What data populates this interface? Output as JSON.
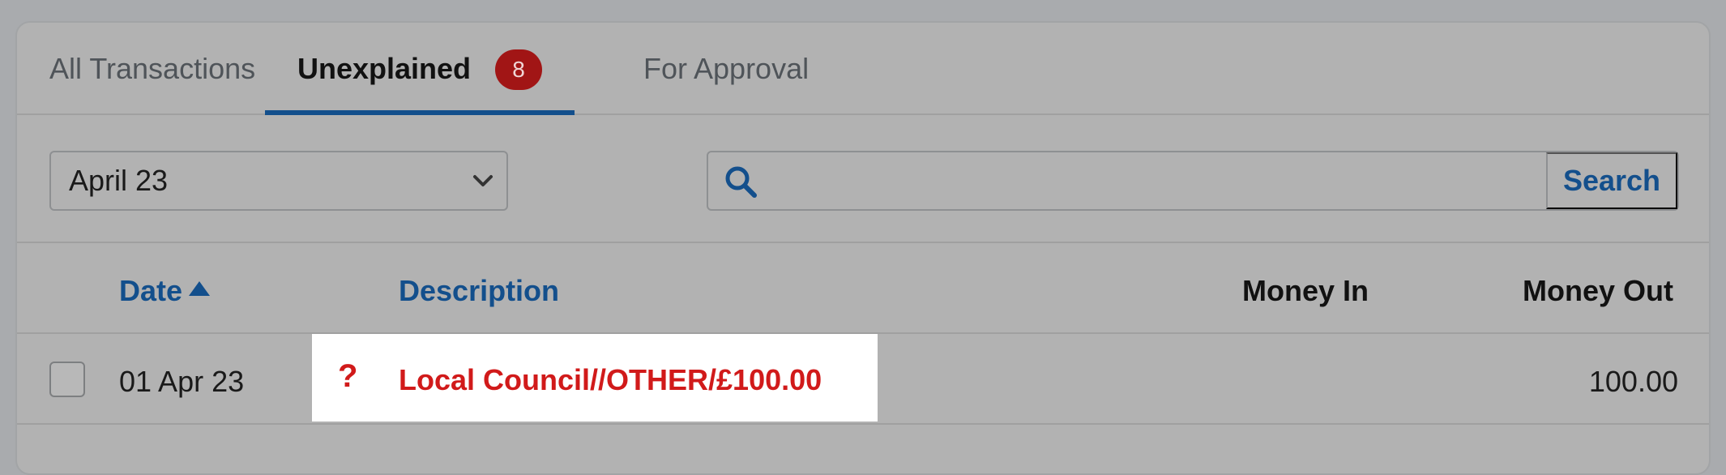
{
  "tabs": [
    {
      "label": "All Transactions"
    },
    {
      "label": "Unexplained",
      "badge": "8"
    },
    {
      "label": "For Approval"
    }
  ],
  "filters": {
    "month": "April 23",
    "search_placeholder": "",
    "search_label": "Search"
  },
  "table": {
    "headers": {
      "date": "Date",
      "description": "Description",
      "money_in": "Money In",
      "money_out": "Money Out"
    },
    "rows": [
      {
        "date": "01 Apr 23",
        "status_icon": "?",
        "description": "Local Council//OTHER/£100.00",
        "money_in": "",
        "money_out": "100.00"
      }
    ]
  },
  "colors": {
    "accent": "#134f8c",
    "badge": "#a11515",
    "alert_text": "#d11a1a"
  }
}
